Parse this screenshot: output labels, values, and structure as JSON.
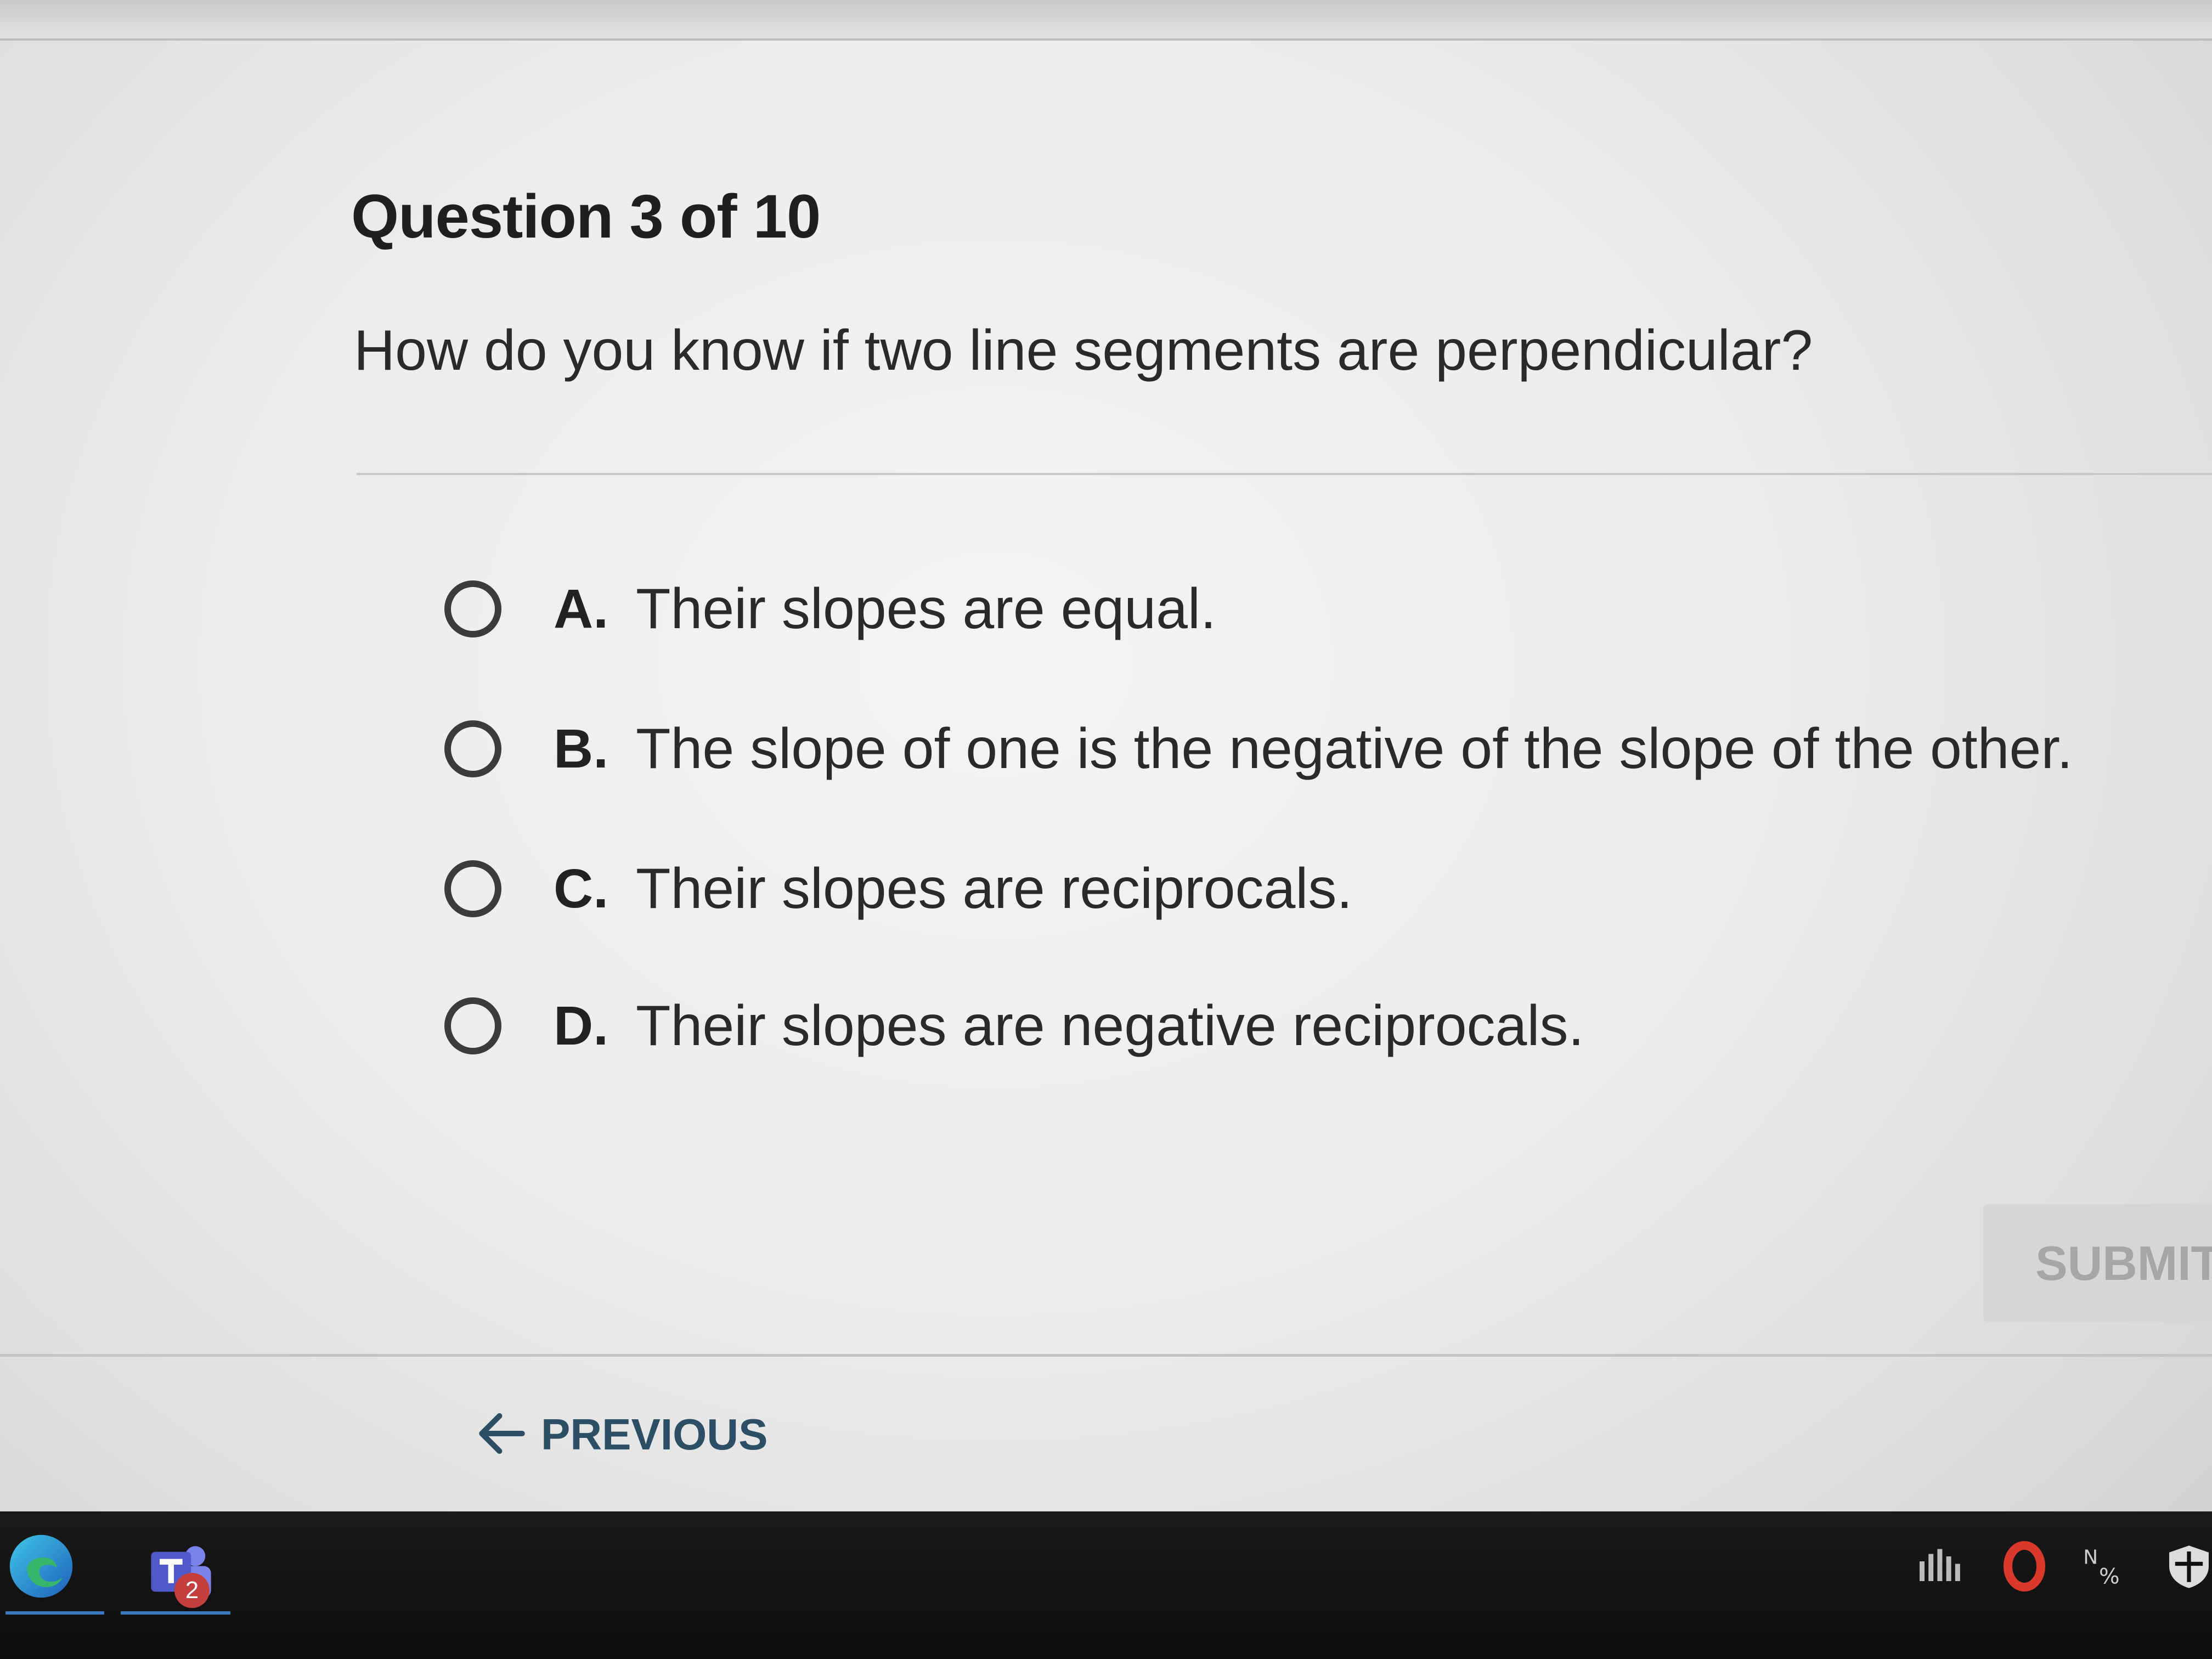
{
  "quiz": {
    "header": "Question 3 of 10",
    "question": "How do you know if two line segments are perpendicular?",
    "choices": [
      {
        "letter": "A.",
        "text": "Their slopes are equal."
      },
      {
        "letter": "B.",
        "text": "The slope of one is the negative of the slope of the other."
      },
      {
        "letter": "C.",
        "text": "Their slopes are reciprocals."
      },
      {
        "letter": "D.",
        "text": "Their slopes are negative reciprocals."
      }
    ],
    "submit_label": "SUBMIT",
    "previous_label": "PREVIOUS"
  },
  "taskbar": {
    "teams_badge_count": "2",
    "icons": [
      "edge-icon",
      "teams-icon",
      "signal-icon",
      "office-icon",
      "language-icon",
      "shield-icon"
    ]
  },
  "colors": {
    "accent_link": "#2c4f66",
    "disabled_button_bg": "#d6d6d6",
    "disabled_button_text": "#a6a6a6",
    "taskbar": "#111111"
  }
}
